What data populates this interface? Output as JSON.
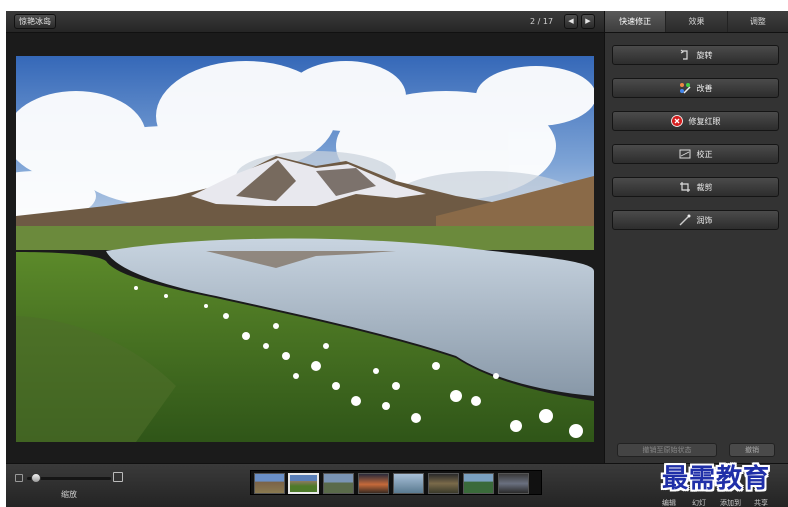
{
  "viewer": {
    "back_label": "惊艳冰岛",
    "counter": "2 / 17",
    "prev_glyph": "◀",
    "next_glyph": "▶"
  },
  "panel": {
    "tabs": [
      {
        "label": "快速修正",
        "active": true
      },
      {
        "label": "效果",
        "active": false
      },
      {
        "label": "调整",
        "active": false
      }
    ],
    "tools": [
      {
        "label": "旋转",
        "icon": "rotate-icon"
      },
      {
        "label": "改善",
        "icon": "enhance-icon"
      },
      {
        "label": "修复红眼",
        "icon": "red-eye-icon"
      },
      {
        "label": "校正",
        "icon": "straighten-icon"
      },
      {
        "label": "裁剪",
        "icon": "crop-icon"
      },
      {
        "label": "润饰",
        "icon": "retouch-icon"
      }
    ],
    "footer_left": "撤销至原始状态",
    "footer_right": "撤销"
  },
  "bottombar": {
    "zoom_label": "缩放",
    "zoom_value": 0.05,
    "labels": [
      "编辑",
      "幻灯",
      "添加到",
      "共享"
    ]
  },
  "colors": {
    "accent_active_tab": "#5a5a5a",
    "red_eye": "#d42020",
    "watermark": "#1f2fa8"
  },
  "watermark": "最需教育"
}
